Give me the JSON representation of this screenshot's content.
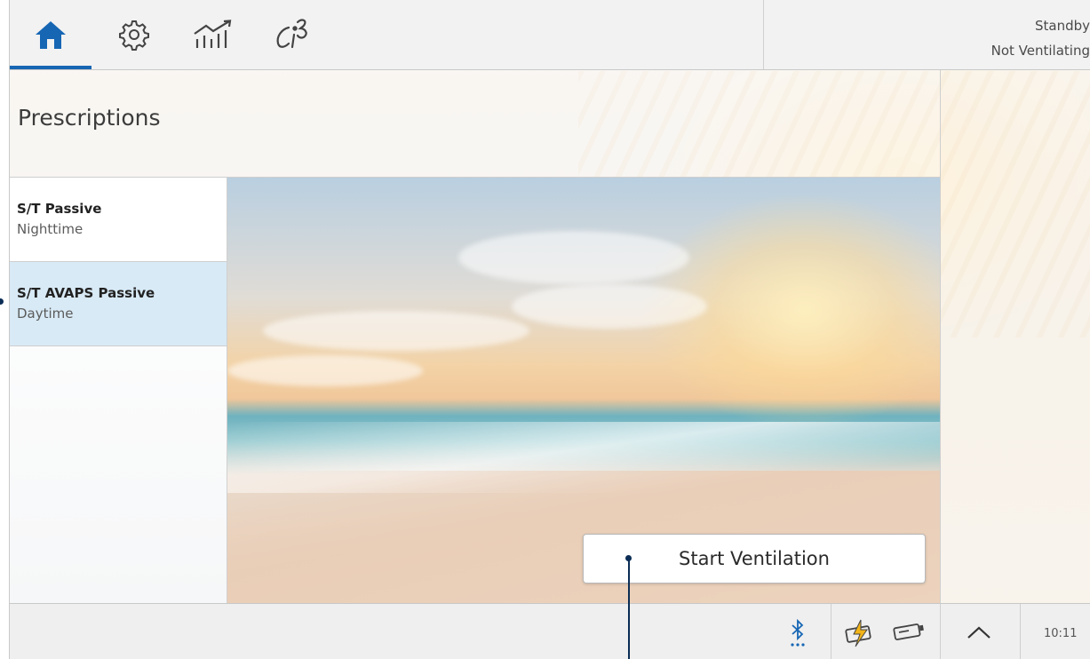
{
  "tabs": [
    {
      "icon": "home-icon",
      "active": true
    },
    {
      "icon": "gear-icon",
      "active": false
    },
    {
      "icon": "trends-chart-icon",
      "active": false
    },
    {
      "icon": "clinician-tools-icon",
      "active": false
    }
  ],
  "status": {
    "line1": "Standby",
    "line2": "Not Ventilating"
  },
  "page": {
    "title": "Prescriptions"
  },
  "prescriptions": [
    {
      "name": "S/T  Passive",
      "period": "Nighttime",
      "selected": false
    },
    {
      "name": "S/T AVAPS Passive",
      "period": "Daytime",
      "selected": true
    }
  ],
  "actions": {
    "start_label": "Start Ventilation"
  },
  "footer": {
    "time": "10:11"
  },
  "colors": {
    "accent": "#1666b4",
    "selected_row": "#d8eaf6",
    "battery_bolt": "#f2b418"
  }
}
